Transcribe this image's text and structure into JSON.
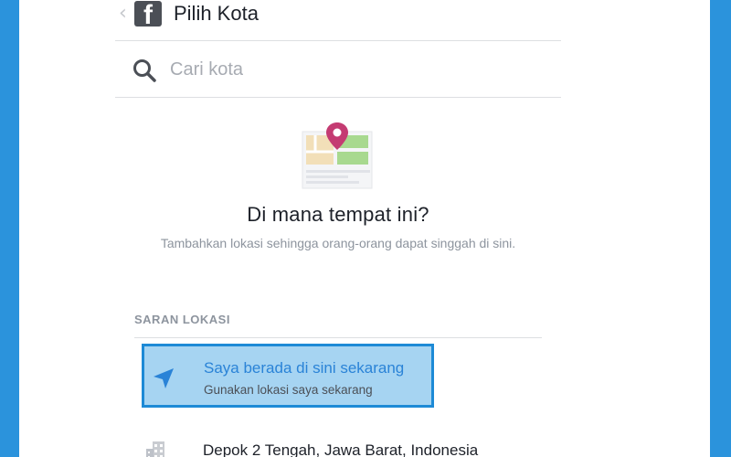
{
  "header": {
    "back_icon": "chevron-left-icon",
    "logo_icon": "facebook-logo-icon",
    "title": "Pilih Kota"
  },
  "search": {
    "icon": "search-icon",
    "placeholder": "Cari kota",
    "value": ""
  },
  "empty_state": {
    "illustration": "map-pin-illustration",
    "heading": "Di mana tempat ini?",
    "description": "Tambahkan lokasi sehingga orang-orang dapat singgah di sini."
  },
  "suggestions": {
    "section_label": "SARAN LOKASI",
    "current_location": {
      "icon": "location-arrow-icon",
      "primary": "Saya berada di sini sekarang",
      "secondary": "Gunakan lokasi saya sekarang"
    },
    "places": [
      {
        "icon": "building-icon",
        "name": "Depok 2 Tengah, Jawa Barat, Indonesia"
      }
    ]
  },
  "colors": {
    "frame_blue": "#2b93dc",
    "highlight_fill": "#a6d4f2",
    "highlight_border": "#1d8ad6",
    "link_blue": "#2a83d7",
    "pin_pink": "#c43b72"
  }
}
